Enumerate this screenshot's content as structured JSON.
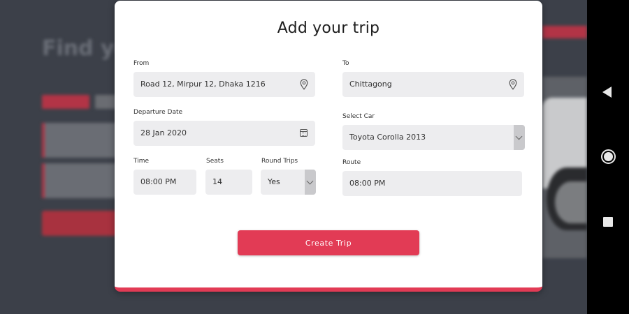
{
  "modal": {
    "title": "Add your trip",
    "from": {
      "label": "From",
      "value": "Road 12, Mirpur 12, Dhaka 1216",
      "icon": "location-pin-icon"
    },
    "to": {
      "label": "To",
      "value": "Chittagong",
      "icon": "location-pin-icon"
    },
    "departure_date": {
      "label": "Departure Date",
      "value": "28 Jan 2020",
      "icon": "calendar-icon"
    },
    "select_car": {
      "label": "Select Car",
      "value": "Toyota Corolla 2013"
    },
    "time": {
      "label": "Time",
      "value": "08:00 PM"
    },
    "seats": {
      "label": "Seats",
      "value": "14"
    },
    "round_trips": {
      "label": "Round Trips",
      "value": "Yes"
    },
    "route": {
      "label": "Route",
      "value": "08:00 PM"
    },
    "create_button": "Create Trip"
  },
  "background": {
    "title": "Find yo"
  },
  "colors": {
    "accent": "#e23b55",
    "field_bg": "#ededef",
    "overlay": "#3c4049"
  }
}
